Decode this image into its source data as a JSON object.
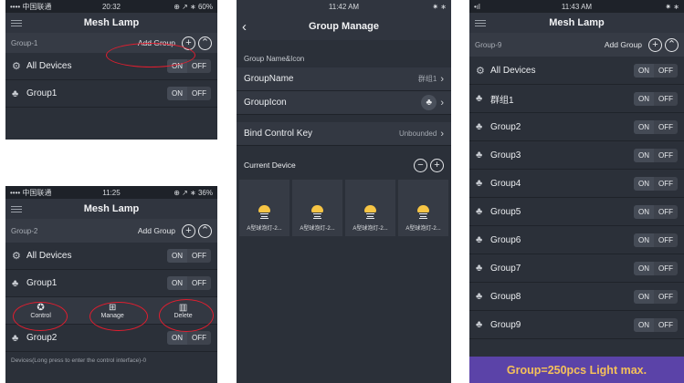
{
  "colors": {
    "panel_bg": "#2b3039",
    "highlight_oval": "#e01e2f",
    "banner_bg": "#5b43a8",
    "banner_text": "#f5c15a"
  },
  "shot1": {
    "status_left": "•••• 中国联通 ",
    "status_time": "20:32",
    "status_right": "⊕ ↗ ∗ 60%",
    "title": "Mesh Lamp",
    "group_label": "Group-1",
    "add_group": "Add Group",
    "rows": [
      {
        "label": "All Devices",
        "on": "ON",
        "off": "OFF"
      },
      {
        "label": "Group1",
        "on": "ON",
        "off": "OFF"
      }
    ]
  },
  "shot2": {
    "status_left": "•••• 中国联通 ",
    "status_time": "11:25",
    "status_right": "⊕ ↗ ∗ 36%",
    "title": "Mesh Lamp",
    "group_label": "Group-2",
    "add_group": "Add Group",
    "rows": [
      {
        "label": "All Devices",
        "on": "ON",
        "off": "OFF"
      },
      {
        "label": "Group1",
        "on": "ON",
        "off": "OFF"
      }
    ],
    "actions": {
      "control": "Control",
      "manage": "Manage",
      "delete": "Delete"
    },
    "row3": {
      "label": "Group2",
      "on": "ON",
      "off": "OFF"
    },
    "footer": "Devices(Long press to enter the control interface)-0"
  },
  "shot3": {
    "status_time": "11:42 AM",
    "status_right": "✷ ∗",
    "title": "Group Manage",
    "section": "Group Name&Icon",
    "group_name_label": "GroupName",
    "group_name_value": "群组1",
    "group_icon_label": "GroupIcon",
    "bind_label": "Bind Control Key",
    "bind_value": "Unbounded",
    "current_device": "Current Device",
    "devices": [
      "A型球泡灯-2...",
      "A型球泡灯-2...",
      "A型球泡灯-2...",
      "A型球泡灯-2..."
    ]
  },
  "shot4": {
    "status_left": "•ıl",
    "status_time": "11:43 AM",
    "status_right": "✷ ∗",
    "title": "Mesh Lamp",
    "group_label": "Group-9",
    "add_group": "Add Group",
    "rows": [
      {
        "label": "All Devices",
        "on": "ON",
        "off": "OFF"
      },
      {
        "label": "群组1",
        "on": "ON",
        "off": "OFF"
      },
      {
        "label": "Group2",
        "on": "ON",
        "off": "OFF"
      },
      {
        "label": "Group3",
        "on": "ON",
        "off": "OFF"
      },
      {
        "label": "Group4",
        "on": "ON",
        "off": "OFF"
      },
      {
        "label": "Group5",
        "on": "ON",
        "off": "OFF"
      },
      {
        "label": "Group6",
        "on": "ON",
        "off": "OFF"
      },
      {
        "label": "Group7",
        "on": "ON",
        "off": "OFF"
      },
      {
        "label": "Group8",
        "on": "ON",
        "off": "OFF"
      },
      {
        "label": "Group9",
        "on": "ON",
        "off": "OFF"
      }
    ],
    "banner": "Group=250pcs  Light max."
  }
}
